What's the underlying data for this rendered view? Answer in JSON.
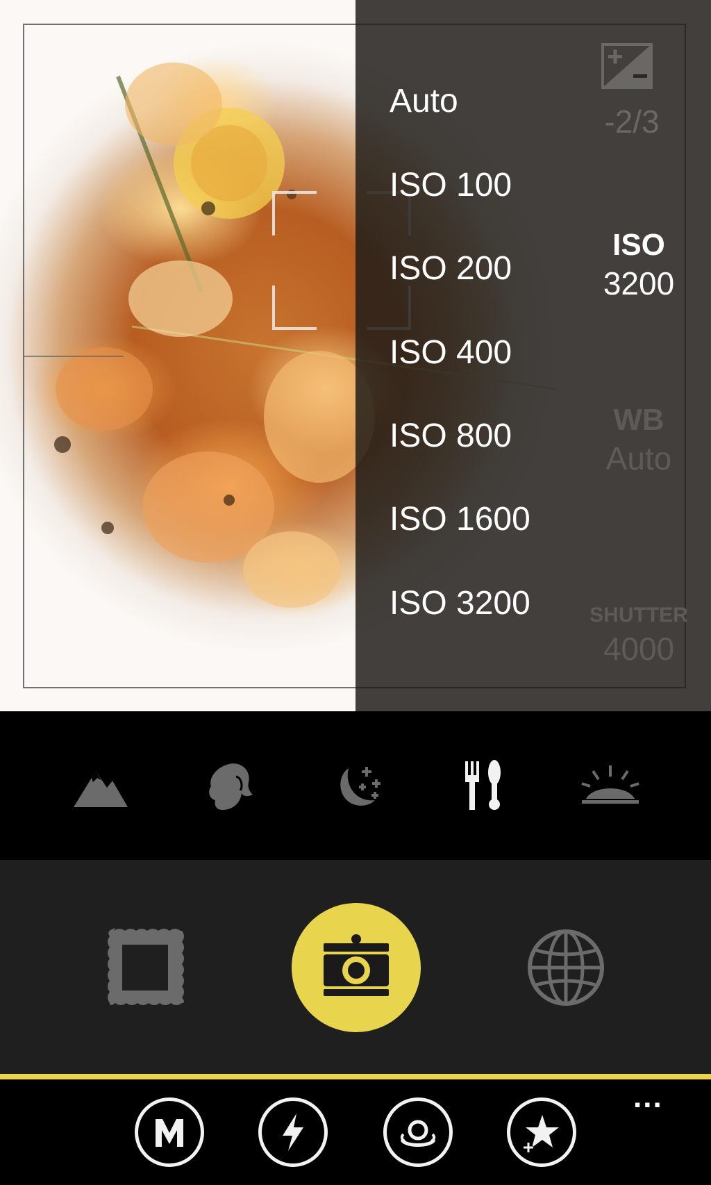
{
  "iso_menu": {
    "options": [
      "Auto",
      "ISO 100",
      "ISO 200",
      "ISO 400",
      "ISO 800",
      "ISO 1600",
      "ISO 3200"
    ]
  },
  "settings": {
    "exposure": {
      "icon": "exposure-compensation-icon",
      "value": "-2/3"
    },
    "iso": {
      "label": "ISO",
      "value": "3200"
    },
    "white_balance": {
      "label": "WB",
      "value": "Auto"
    },
    "shutter": {
      "label": "SHUTTER",
      "value": "4000"
    }
  },
  "scene_modes": [
    {
      "icon": "landscape-icon",
      "active": false
    },
    {
      "icon": "portrait-icon",
      "active": false
    },
    {
      "icon": "night-icon",
      "active": true
    },
    {
      "icon": "food-icon",
      "active": true
    },
    {
      "icon": "sunset-icon",
      "active": false
    }
  ],
  "capture_controls": [
    {
      "icon": "frame-icon"
    },
    {
      "icon": "camera-shutter-icon"
    },
    {
      "icon": "globe-icon"
    }
  ],
  "bottom_bar": {
    "buttons": [
      {
        "icon": "manual-mode-icon",
        "text": "M"
      },
      {
        "icon": "flash-icon"
      },
      {
        "icon": "lens-swap-icon"
      },
      {
        "icon": "effects-icon"
      }
    ],
    "more": "..."
  },
  "colors": {
    "accent": "#e9d54d",
    "panel": "#1f1f1f",
    "inactive_icon": "#6b6b6b",
    "active_icon": "#f2f2f2"
  }
}
